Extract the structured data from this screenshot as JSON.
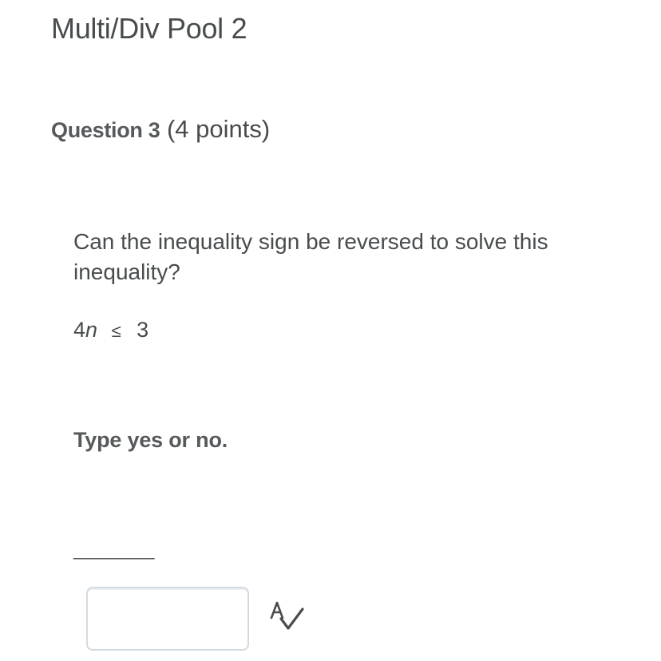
{
  "header": {
    "pool_title": "Multi/Div Pool 2"
  },
  "question": {
    "label": "Question 3",
    "points": "(4 points)",
    "prompt": "Can the inequality sign be reversed to solve this inequality?",
    "equation": {
      "coefficient": "4",
      "variable": "n",
      "operator": "≤",
      "rhs": "3"
    },
    "instruction": "Type yes or no.",
    "blank": "________"
  },
  "answer": {
    "value": "",
    "placeholder": ""
  },
  "icons": {
    "spellcheck": "spellcheck-icon"
  },
  "colors": {
    "text": "#494c4e",
    "input_border": "#d3d9e3"
  }
}
